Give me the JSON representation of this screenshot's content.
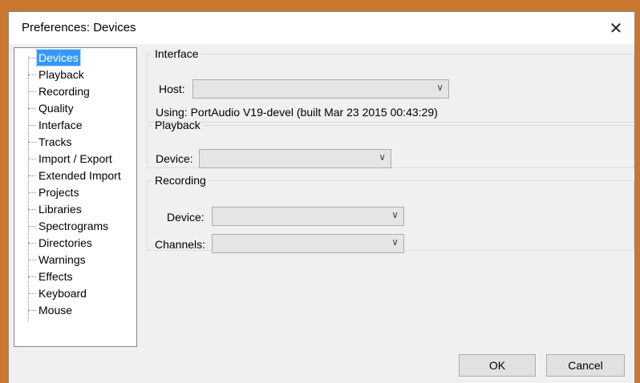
{
  "window": {
    "title": "Preferences: Devices",
    "close_glyph": "✕"
  },
  "tree": {
    "items": [
      {
        "label": "Devices",
        "selected": true
      },
      {
        "label": "Playback"
      },
      {
        "label": "Recording"
      },
      {
        "label": "Quality"
      },
      {
        "label": "Interface"
      },
      {
        "label": "Tracks"
      },
      {
        "label": "Import / Export"
      },
      {
        "label": "Extended Import"
      },
      {
        "label": "Projects"
      },
      {
        "label": "Libraries"
      },
      {
        "label": "Spectrograms"
      },
      {
        "label": "Directories"
      },
      {
        "label": "Warnings"
      },
      {
        "label": "Effects"
      },
      {
        "label": "Keyboard"
      },
      {
        "label": "Mouse"
      }
    ]
  },
  "interface": {
    "legend": "Interface",
    "host_label": "Host:",
    "host_value": "",
    "using_text": "Using: PortAudio V19-devel (built Mar 23 2015 00:43:29)"
  },
  "playback": {
    "legend": "Playback",
    "device_label": "Device:",
    "device_value": ""
  },
  "recording": {
    "legend": "Recording",
    "device_label": "Device:",
    "device_value": "",
    "channels_label": "Channels:",
    "channels_value": ""
  },
  "buttons": {
    "ok": "OK",
    "cancel": "Cancel"
  },
  "icons": {
    "chevron": "chevron-down-icon",
    "close": "close-icon"
  },
  "colors": {
    "accent": "#3399ff",
    "frame": "#c9772f"
  }
}
